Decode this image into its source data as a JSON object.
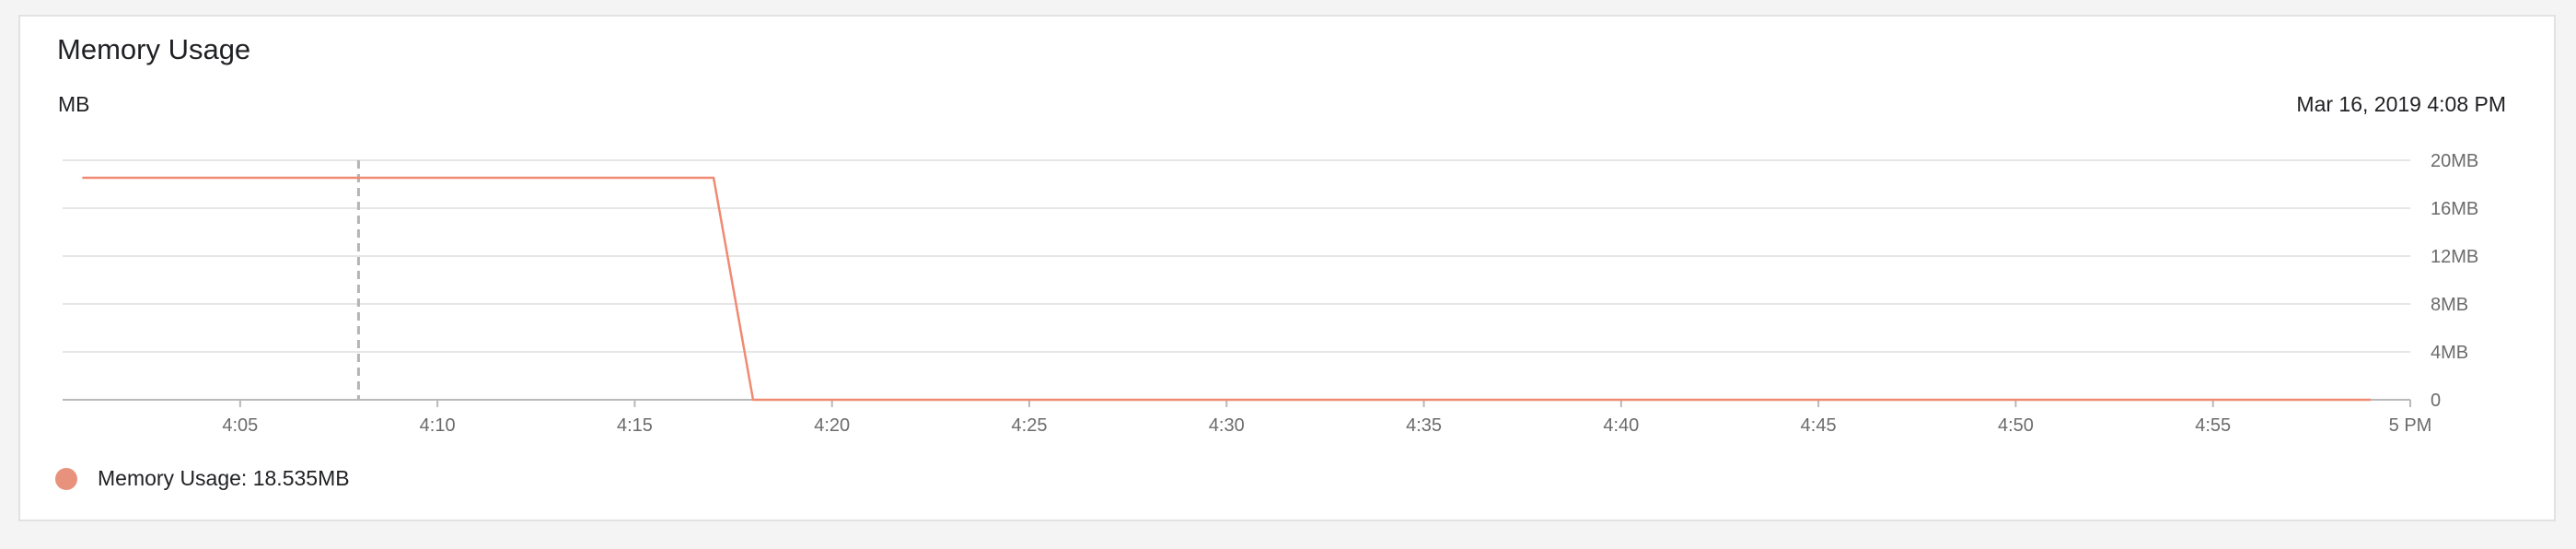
{
  "card": {
    "title": "Memory Usage",
    "unit_label": "MB",
    "timestamp": "Mar 16, 2019 4:08 PM"
  },
  "legend": {
    "text": "Memory Usage: 18.535MB",
    "color": "#e8927e"
  },
  "chart_data": {
    "type": "line",
    "title": "Memory Usage",
    "ylabel": "MB",
    "x_ticks": [
      "4:05",
      "4:10",
      "4:15",
      "4:20",
      "4:25",
      "4:30",
      "4:35",
      "4:40",
      "4:45",
      "4:50",
      "4:55",
      "5 PM"
    ],
    "y_ticks": [
      "0",
      "4MB",
      "8MB",
      "12MB",
      "16MB",
      "20MB"
    ],
    "y_tick_values": [
      0,
      4,
      8,
      12,
      16,
      20
    ],
    "ylim": [
      0,
      20
    ],
    "xlim": [
      "4:00:30",
      "5:00"
    ],
    "grid": true,
    "series": [
      {
        "name": "Memory Usage",
        "color": "#f08a72",
        "points": [
          {
            "x": "4:01",
            "y": 18.535
          },
          {
            "x": "4:17",
            "y": 18.535
          },
          {
            "x": "4:18",
            "y": 0
          },
          {
            "x": "4:59",
            "y": 0
          }
        ]
      }
    ],
    "hover_marker_time": "4:08"
  }
}
